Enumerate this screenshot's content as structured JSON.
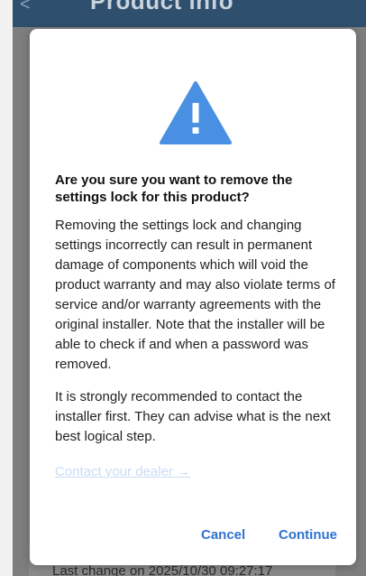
{
  "app_bar": {
    "back_glyph": "<",
    "title": "Product info"
  },
  "background": {
    "footer_text": "Last change on 2025/10/30 09:27:17"
  },
  "dialog": {
    "icon": "warning-triangle-icon",
    "heading": "Are you sure you want to remove the settings lock for this product?",
    "paragraph1": "Removing the settings lock and changing settings incorrectly can result in permanent damage of components which will void the product warranty and may also violate terms of service and/or warranty agreements with the original installer. Note that the installer will be able to check if and when a password was removed.",
    "paragraph2": "It is strongly recommended to contact the installer first. They can advise what is the next best logical step.",
    "dealer_link": "Contact your dealer →",
    "cancel_label": "Cancel",
    "continue_label": "Continue"
  },
  "colors": {
    "app_bar": "#2f4f6f",
    "scrim": "#7e7e7e",
    "icon": "#4a90e2",
    "button_text": "#2f73d0",
    "link_disabled": "#c9dcf5"
  }
}
